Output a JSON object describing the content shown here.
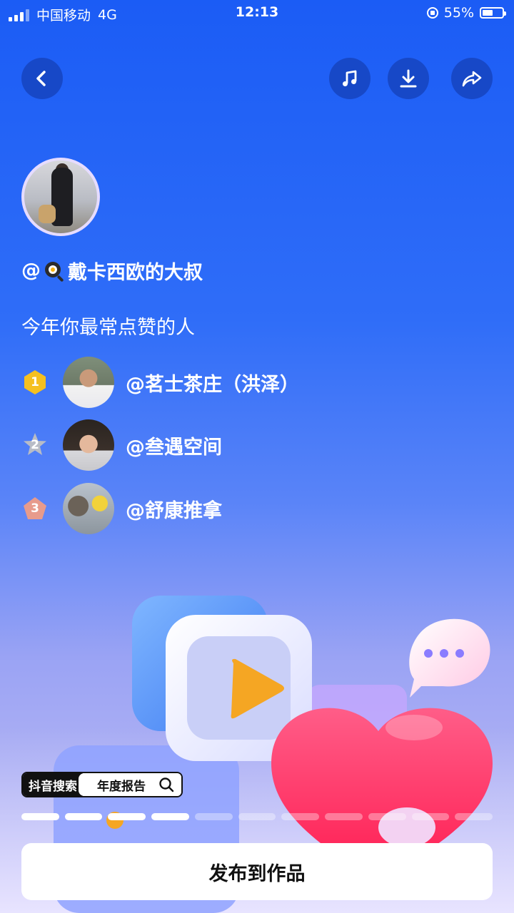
{
  "status_bar": {
    "carrier": "中国移动",
    "network": "4G",
    "time": "12:13",
    "battery": "55%",
    "battery_level": 0.55
  },
  "top_actions": {
    "back_icon": "chevron-left-icon",
    "music_icon": "music-note-icon",
    "download_icon": "download-icon",
    "share_icon": "share-arrow-icon"
  },
  "profile": {
    "at_sign": "@",
    "username_emoji": "frying-pan-egg-icon",
    "username": "戴卡西欧的大叔"
  },
  "subtitle": "今年你最常点赞的人",
  "ranking": [
    {
      "rank": "1",
      "name": "@茗士茶庄（洪泽）",
      "badge_color": "#f5c020"
    },
    {
      "rank": "2",
      "name": "@叁遇空间",
      "badge_color": "#b8bcc6"
    },
    {
      "rank": "3",
      "name": "@舒康推拿",
      "badge_color": "#e79b8c"
    }
  ],
  "search_chip": {
    "brand": "抖音搜索",
    "query": "年度报告"
  },
  "progress": {
    "total_segments": 11,
    "active_segments": 4
  },
  "publish_button": "发布到作品",
  "colors": {
    "background_top": "#1b5cf5",
    "button_circle": "#1748c7",
    "heart": "#ff2d6a",
    "play": "#f5a623"
  }
}
